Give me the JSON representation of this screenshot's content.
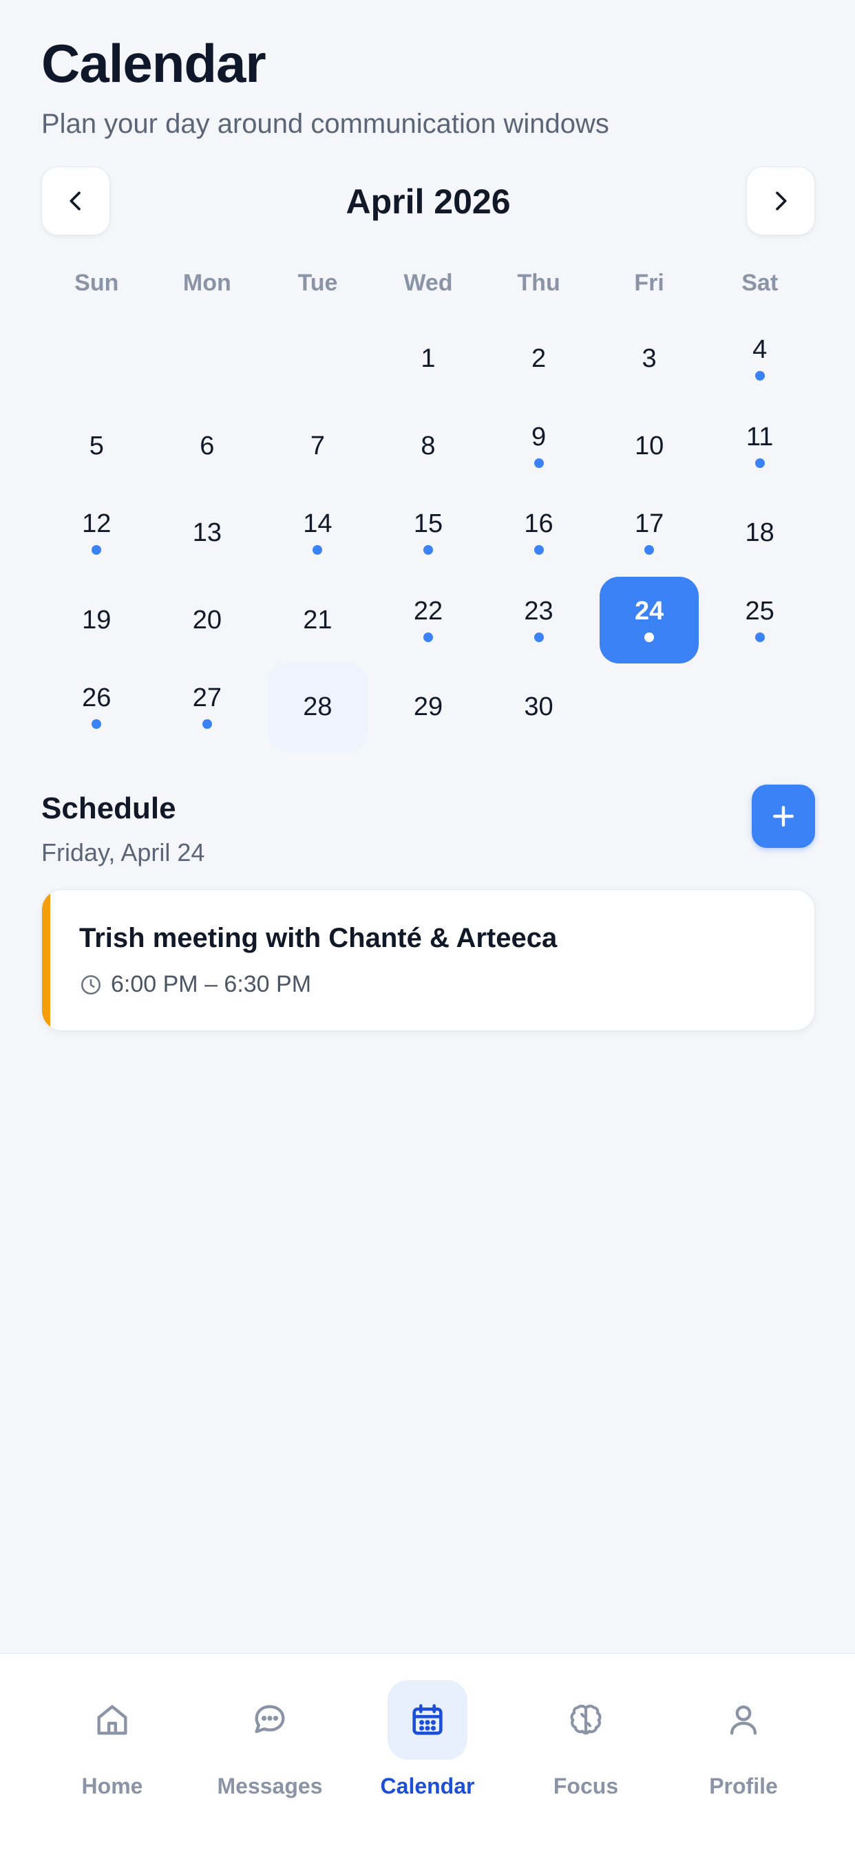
{
  "header": {
    "title": "Calendar",
    "subtitle": "Plan your day around communication windows"
  },
  "month_nav": {
    "label": "April 2026",
    "prev_icon": "chevron-left-icon",
    "next_icon": "chevron-right-icon"
  },
  "weekdays": [
    "Sun",
    "Mon",
    "Tue",
    "Wed",
    "Thu",
    "Fri",
    "Sat"
  ],
  "calendar": {
    "leading_blanks": 3,
    "selected_day": "24",
    "today_day": "28",
    "days": [
      {
        "n": "1",
        "dot": false
      },
      {
        "n": "2",
        "dot": false
      },
      {
        "n": "3",
        "dot": false
      },
      {
        "n": "4",
        "dot": true
      },
      {
        "n": "5",
        "dot": false
      },
      {
        "n": "6",
        "dot": false
      },
      {
        "n": "7",
        "dot": false
      },
      {
        "n": "8",
        "dot": false
      },
      {
        "n": "9",
        "dot": true
      },
      {
        "n": "10",
        "dot": false
      },
      {
        "n": "11",
        "dot": true
      },
      {
        "n": "12",
        "dot": true
      },
      {
        "n": "13",
        "dot": false
      },
      {
        "n": "14",
        "dot": true
      },
      {
        "n": "15",
        "dot": true
      },
      {
        "n": "16",
        "dot": true
      },
      {
        "n": "17",
        "dot": true
      },
      {
        "n": "18",
        "dot": false
      },
      {
        "n": "19",
        "dot": false
      },
      {
        "n": "20",
        "dot": false
      },
      {
        "n": "21",
        "dot": false
      },
      {
        "n": "22",
        "dot": true
      },
      {
        "n": "23",
        "dot": true
      },
      {
        "n": "24",
        "dot": true
      },
      {
        "n": "25",
        "dot": true
      },
      {
        "n": "26",
        "dot": true
      },
      {
        "n": "27",
        "dot": true
      },
      {
        "n": "28",
        "dot": false
      },
      {
        "n": "29",
        "dot": false
      },
      {
        "n": "30",
        "dot": false
      }
    ],
    "dot_color": "#3b82f6",
    "selected_color": "#3b82f6"
  },
  "schedule": {
    "title": "Schedule",
    "date": "Friday, April 24",
    "add_icon": "plus-icon"
  },
  "events": [
    {
      "title": "Trish meeting with Chanté & Arteeca",
      "time": "6:00 PM – 6:30 PM",
      "accent": "#f59e0b",
      "icon": "clock-icon"
    }
  ],
  "tabbar": {
    "active": "Calendar",
    "tabs": [
      {
        "label": "Home",
        "icon": "home-icon"
      },
      {
        "label": "Messages",
        "icon": "chat-bubble-icon"
      },
      {
        "label": "Calendar",
        "icon": "calendar-icon"
      },
      {
        "label": "Focus",
        "icon": "brain-icon"
      },
      {
        "label": "Profile",
        "icon": "user-icon"
      }
    ]
  }
}
